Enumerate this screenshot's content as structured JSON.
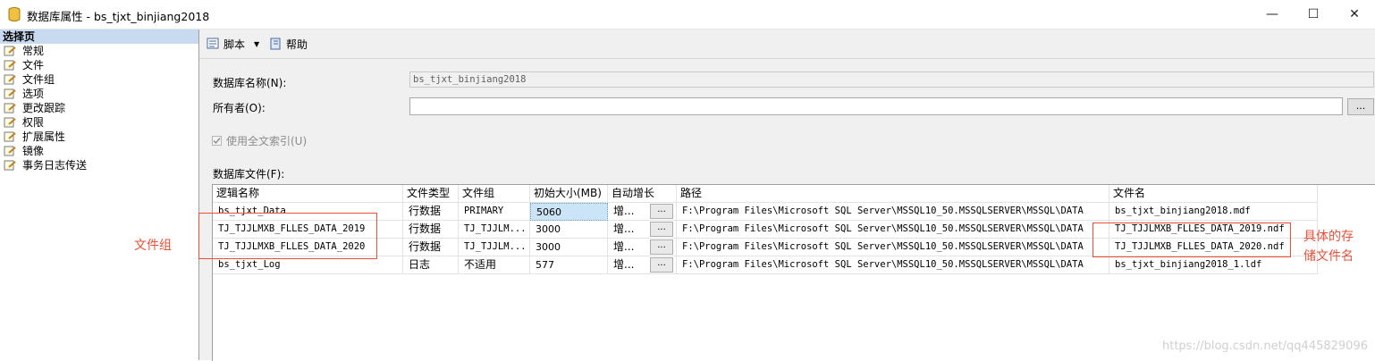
{
  "window": {
    "title": "数据库属性 - bs_tjxt_binjiang2018",
    "minimize": "—",
    "maximize": "☐",
    "close": "✕"
  },
  "left_pane": {
    "header": "选择页",
    "items": [
      {
        "label": "常规"
      },
      {
        "label": "文件"
      },
      {
        "label": "文件组"
      },
      {
        "label": "选项"
      },
      {
        "label": "更改跟踪"
      },
      {
        "label": "权限"
      },
      {
        "label": "扩展属性"
      },
      {
        "label": "镜像"
      },
      {
        "label": "事务日志传送"
      }
    ]
  },
  "toolbar": {
    "script_label": "脚本",
    "script_dropdown": "▼",
    "help_label": "帮助"
  },
  "form": {
    "db_name_label": "数据库名称(N):",
    "db_name_value": "bs_tjxt_binjiang2018",
    "owner_label": "所有者(O):",
    "owner_value": "",
    "owner_browse": "...",
    "fulltext_label": "使用全文索引(U)",
    "fulltext_checked": true,
    "db_files_label": "数据库文件(F):"
  },
  "grid": {
    "columns": [
      "逻辑名称",
      "文件类型",
      "文件组",
      "初始大小(MB)",
      "自动增长",
      "路径",
      "文件名"
    ],
    "rows": [
      {
        "logical": "bs_tjxt_Data",
        "type": "行数据",
        "group": "PRIMARY",
        "size": "5060",
        "growth": "增...",
        "btn": "...",
        "path": "F:\\Program Files\\Microsoft SQL Server\\MSSQL10_50.MSSQLSERVER\\MSSQL\\DATA",
        "file": "bs_tjxt_binjiang2018.mdf"
      },
      {
        "logical": "TJ_TJJLMXB_FLLES_DATA_2019",
        "type": "行数据",
        "group": "TJ_TJJLM...",
        "size": "3000",
        "growth": "增...",
        "btn": "...",
        "path": "F:\\Program Files\\Microsoft SQL Server\\MSSQL10_50.MSSQLSERVER\\MSSQL\\DATA",
        "file": "TJ_TJJLMXB_FLLES_DATA_2019.ndf"
      },
      {
        "logical": "TJ_TJJLMXB_FLLES_DATA_2020",
        "type": "行数据",
        "group": "TJ_TJJLM...",
        "size": "3000",
        "growth": "增...",
        "btn": "...",
        "path": "F:\\Program Files\\Microsoft SQL Server\\MSSQL10_50.MSSQLSERVER\\MSSQL\\DATA",
        "file": "TJ_TJJLMXB_FLLES_DATA_2020.ndf"
      },
      {
        "logical": "bs_tjxt_Log",
        "type": "日志",
        "group": "不适用",
        "size": "577",
        "growth": "增...",
        "btn": "...",
        "path": "F:\\Program Files\\Microsoft SQL Server\\MSSQL10_50.MSSQLSERVER\\MSSQL\\DATA",
        "file": "bs_tjxt_binjiang2018_1.ldf"
      }
    ]
  },
  "annotations": {
    "filegroup_note": "文件组",
    "storage_note_line1": "具体的存",
    "storage_note_line2": "储文件名",
    "color": "#e8503a"
  },
  "watermark": "https://blog.csdn.net/qq445829096"
}
